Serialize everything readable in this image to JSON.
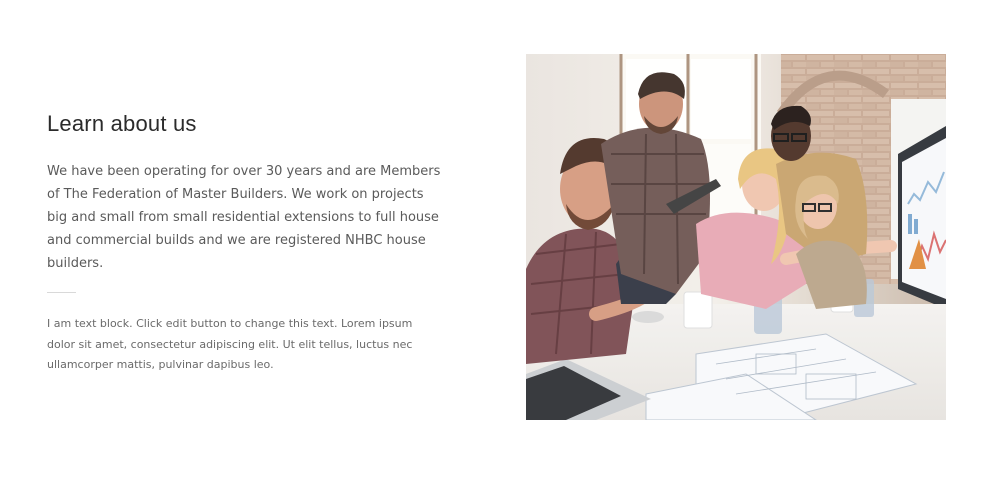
{
  "about": {
    "heading": "Learn about us",
    "lead": "We have been operating for over 30 years and are Members of The Federation of Master Builders. We work on projects big and small from small residential extensions to full house and commercial builds and we are registered NHBC house builders.",
    "body": "I am text block. Click edit button to change this text. Lorem ipsum dolor sit amet, consectetur adipiscing elit. Ut elit tellus, luctus nec ullamcorper mattis, pulvinar dapibus leo."
  },
  "colors": {
    "heading": "#2b2b2b",
    "lead": "#5a5a5a",
    "body": "#6a6a6a",
    "divider": "#d9d9d9"
  },
  "image": {
    "alt": "team-photo",
    "description_icon": "team-meeting-photo"
  }
}
